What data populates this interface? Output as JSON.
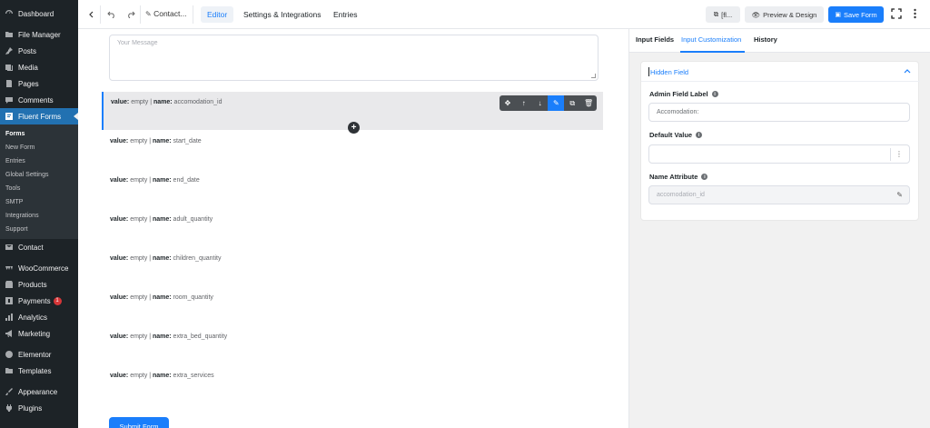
{
  "sidebar": {
    "dashboard": "Dashboard",
    "file_manager": "File Manager",
    "posts": "Posts",
    "media": "Media",
    "pages": "Pages",
    "comments": "Comments",
    "fluent_forms": "Fluent Forms",
    "submenu": [
      "Forms",
      "New Form",
      "Entries",
      "Global Settings",
      "Tools",
      "SMTP",
      "Integrations",
      "Support"
    ],
    "contact": "Contact",
    "woocommerce": "WooCommerce",
    "products": "Products",
    "payments": "Payments",
    "payments_badge": "1",
    "analytics": "Analytics",
    "marketing": "Marketing",
    "elementor": "Elementor",
    "templates": "Templates",
    "appearance": "Appearance",
    "plugins": "Plugins"
  },
  "topbar": {
    "form_title": "Contact...",
    "tab_editor": "Editor",
    "tab_settings": "Settings & Integrations",
    "tab_entries": "Entries",
    "shortcode_btn": "[fl...",
    "preview_btn": "Preview & Design",
    "save_btn": "Save Form"
  },
  "editor": {
    "message_placeholder": "Your Message",
    "value_label": "value:",
    "value_text": "empty",
    "name_label": "name:",
    "fields": [
      "accomodation_id",
      "start_date",
      "end_date",
      "adult_quantity",
      "children_quantity",
      "room_quantity",
      "extra_bed_quantity",
      "extra_services"
    ],
    "submit_btn": "Submit Form"
  },
  "panel": {
    "tabs": [
      "Input Fields",
      "Input Customization",
      "History"
    ],
    "section_title": "Hidden Field",
    "admin_label_title": "Admin Field Label",
    "admin_label_value": "Accomodation:",
    "default_value_title": "Default Value",
    "default_value": "",
    "name_attr_title": "Name Attribute",
    "name_attr_value": "accomodation_id"
  },
  "colors": {
    "accent": "#1a7efb",
    "sidebar_bg": "#1d2327",
    "wp_blue": "#2271b1"
  }
}
